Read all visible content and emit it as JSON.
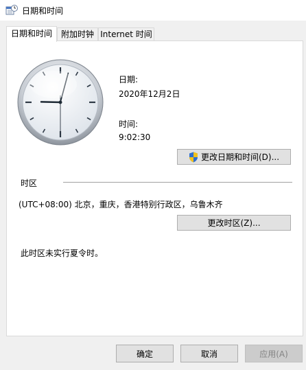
{
  "window": {
    "title": "日期和时间",
    "icon": "datetime-app-icon"
  },
  "tabs": [
    {
      "label": "日期和时间",
      "active": true
    },
    {
      "label": "附加时钟",
      "active": false
    },
    {
      "label": "Internet 时间",
      "active": false
    }
  ],
  "datetime": {
    "date_label": "日期:",
    "date_value": "2020年12月2日",
    "time_label": "时间:",
    "time_value": "9:02:30",
    "change_button": "更改日期和时间(D)..."
  },
  "timezone": {
    "section_label": "时区",
    "value": "(UTC+08:00) 北京，重庆，香港特别行政区，乌鲁木齐",
    "change_button": "更改时区(Z)...",
    "dst_note": "此时区未实行夏令时。"
  },
  "footer": {
    "ok": "确定",
    "cancel": "取消",
    "apply": "应用(A)"
  },
  "clock": {
    "hours": 9,
    "minutes": 2,
    "seconds": 30
  },
  "colors": {
    "shield_blue": "#2f6fd0",
    "shield_yellow": "#f3c21b"
  }
}
